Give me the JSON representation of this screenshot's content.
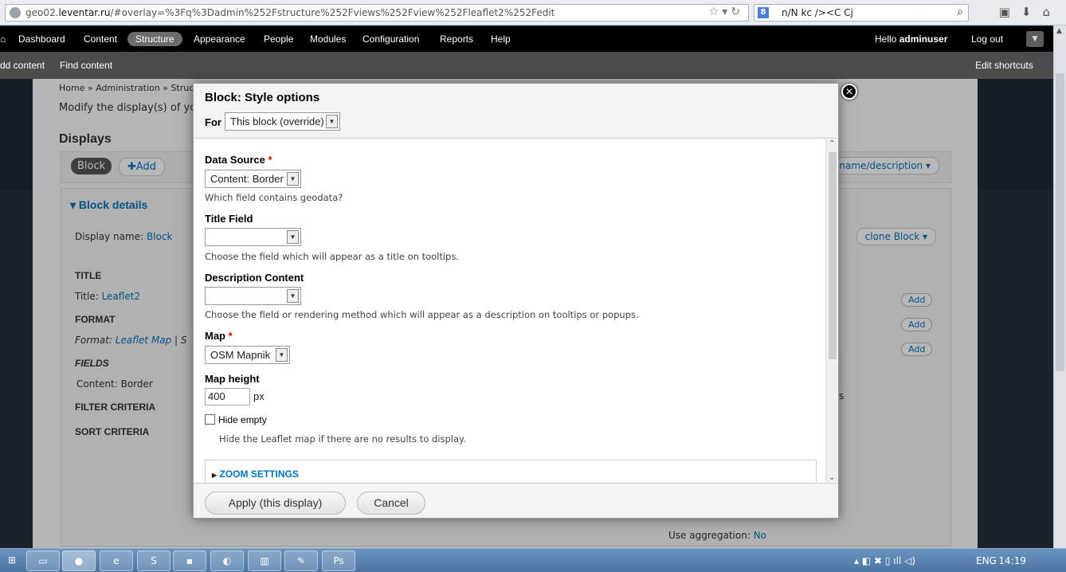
{
  "browser": {
    "url_prefix": "geo02.",
    "url_domain": "leventar.ru",
    "url_rest": "/#overlay=%3Fq%3Dadmin%252Fstructure%252Fviews%252Fview%252Fleaflet2%252Fedit",
    "search_engine_badge": "8",
    "search_text": "n/N kc /><C Cj"
  },
  "toolbar": {
    "items": [
      "Dashboard",
      "Content",
      "Structure",
      "Appearance",
      "People",
      "Modules",
      "Configuration",
      "Reports",
      "Help"
    ],
    "hello": "Hello ",
    "user": "adminuser",
    "logout": "Log out",
    "toggle": "▼"
  },
  "shortcuts": {
    "add_content": "dd content",
    "find_content": "Find content",
    "edit_shortcuts": "Edit shortcuts"
  },
  "background_page": {
    "breadcrumb": "Home » Administration » Struct",
    "intro": "Modify the display(s) of yo",
    "displays_heading": "Displays",
    "block_tab": "Block",
    "add_tab": "✚Add",
    "name_desc_pill": "name/description",
    "block_details": "▾ Block details",
    "display_name_label": "Display name: ",
    "display_name_value": "Block",
    "clone_block": "clone Block",
    "title_heading": "TITLE",
    "title_label": "Title: ",
    "title_value": "Leaflet2",
    "format_heading": "FORMAT",
    "format_label": "Format: ",
    "format_value": "Leaflet Map",
    "format_sep": "|  S",
    "fields_heading": "FIELDS",
    "field_value": "Content: Border",
    "filter_heading": "FILTER CRITERIA",
    "sort_heading": "SORT CRITERIA",
    "add_button": "Add",
    "use_aggregation_label": "Use aggregation: ",
    "use_aggregation_value": "No",
    "trailing_s": "s"
  },
  "modal": {
    "title": "Block: Style options",
    "for_label": "For",
    "for_value": "This block (override)",
    "close": "✕",
    "data_source_label": "Data Source ",
    "data_source_value": "Content: Border",
    "data_source_desc": "Which field contains geodata?",
    "title_field_label": "Title Field",
    "title_field_value": "",
    "title_field_desc": "Choose the field which will appear as a title on tooltips.",
    "description_label": "Description Content",
    "description_value": "",
    "description_desc": "Choose the field or rendering method which will appear as a description on tooltips or popups.",
    "map_label": "Map ",
    "map_value": "OSM Mapnik",
    "map_height_label": "Map height",
    "map_height_value": "400",
    "map_height_unit": "px",
    "hide_empty_label": "Hide empty",
    "hide_empty_desc": "Hide the Leaflet map if there are no results to display.",
    "zoom_settings": "ZOOM SETTINGS",
    "required_mark": "*",
    "apply_button": "Apply (this display)",
    "cancel_button": "Cancel"
  },
  "taskbar": {
    "lang": "ENG",
    "time": "14:19"
  }
}
